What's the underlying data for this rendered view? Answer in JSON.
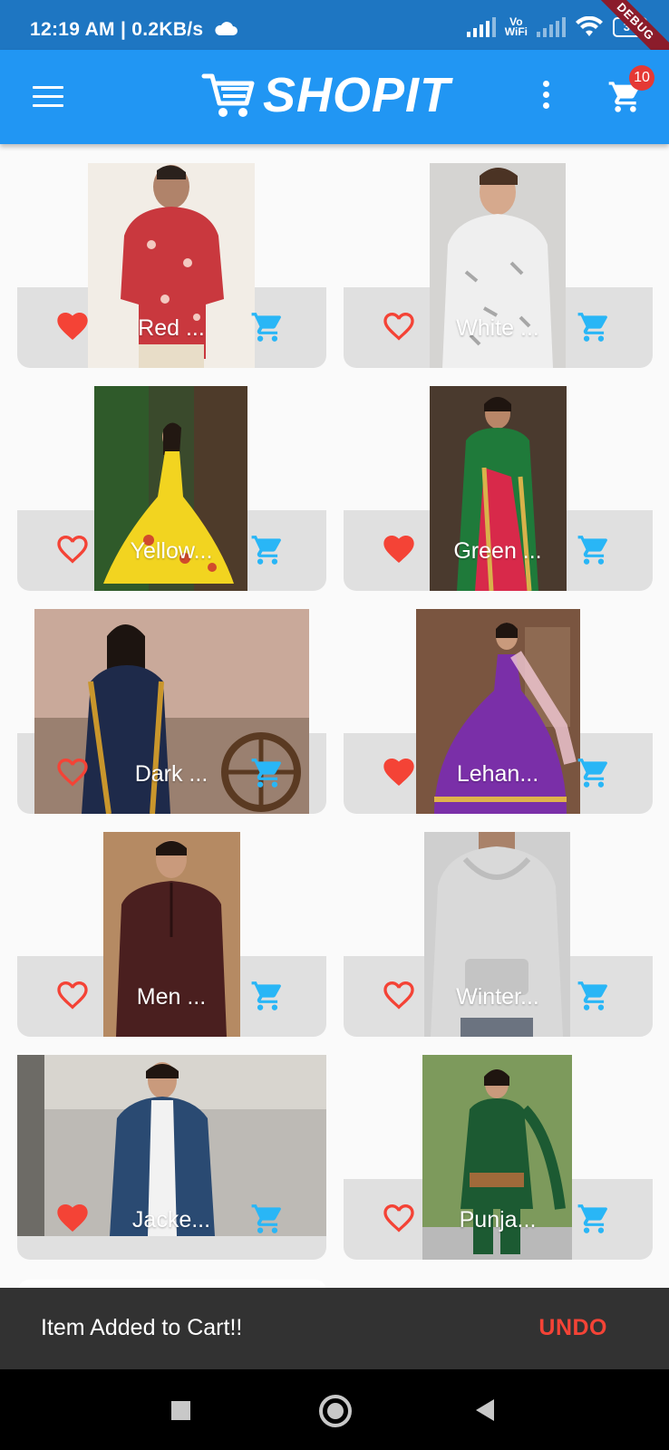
{
  "status": {
    "time_speed": "12:19 AM | 0.2KB/s",
    "volte_top": "Vo",
    "volte_bottom": "WiFi",
    "battery": "30",
    "debug_label": "DEBUG"
  },
  "appbar": {
    "title": "SHOPIT",
    "cart_count": "10"
  },
  "products": [
    {
      "title": "Red ...",
      "favorited": true
    },
    {
      "title": "White ...",
      "favorited": false
    },
    {
      "title": "Yellow...",
      "favorited": false
    },
    {
      "title": "Green ...",
      "favorited": true
    },
    {
      "title": "Dark ...",
      "favorited": false
    },
    {
      "title": "Lehan...",
      "favorited": true
    },
    {
      "title": "Men ...",
      "favorited": false
    },
    {
      "title": "Winter...",
      "favorited": false
    },
    {
      "title": "Jacke...",
      "favorited": true
    },
    {
      "title": "Punja...",
      "favorited": false
    }
  ],
  "snackbar": {
    "message": "Item Added to Cart!!",
    "action": "UNDO"
  },
  "colors": {
    "appbar": "#2196f3",
    "statusbar": "#1e76c2",
    "heart": "#f44336",
    "cart": "#29b6f6",
    "snackbar": "#323232"
  }
}
